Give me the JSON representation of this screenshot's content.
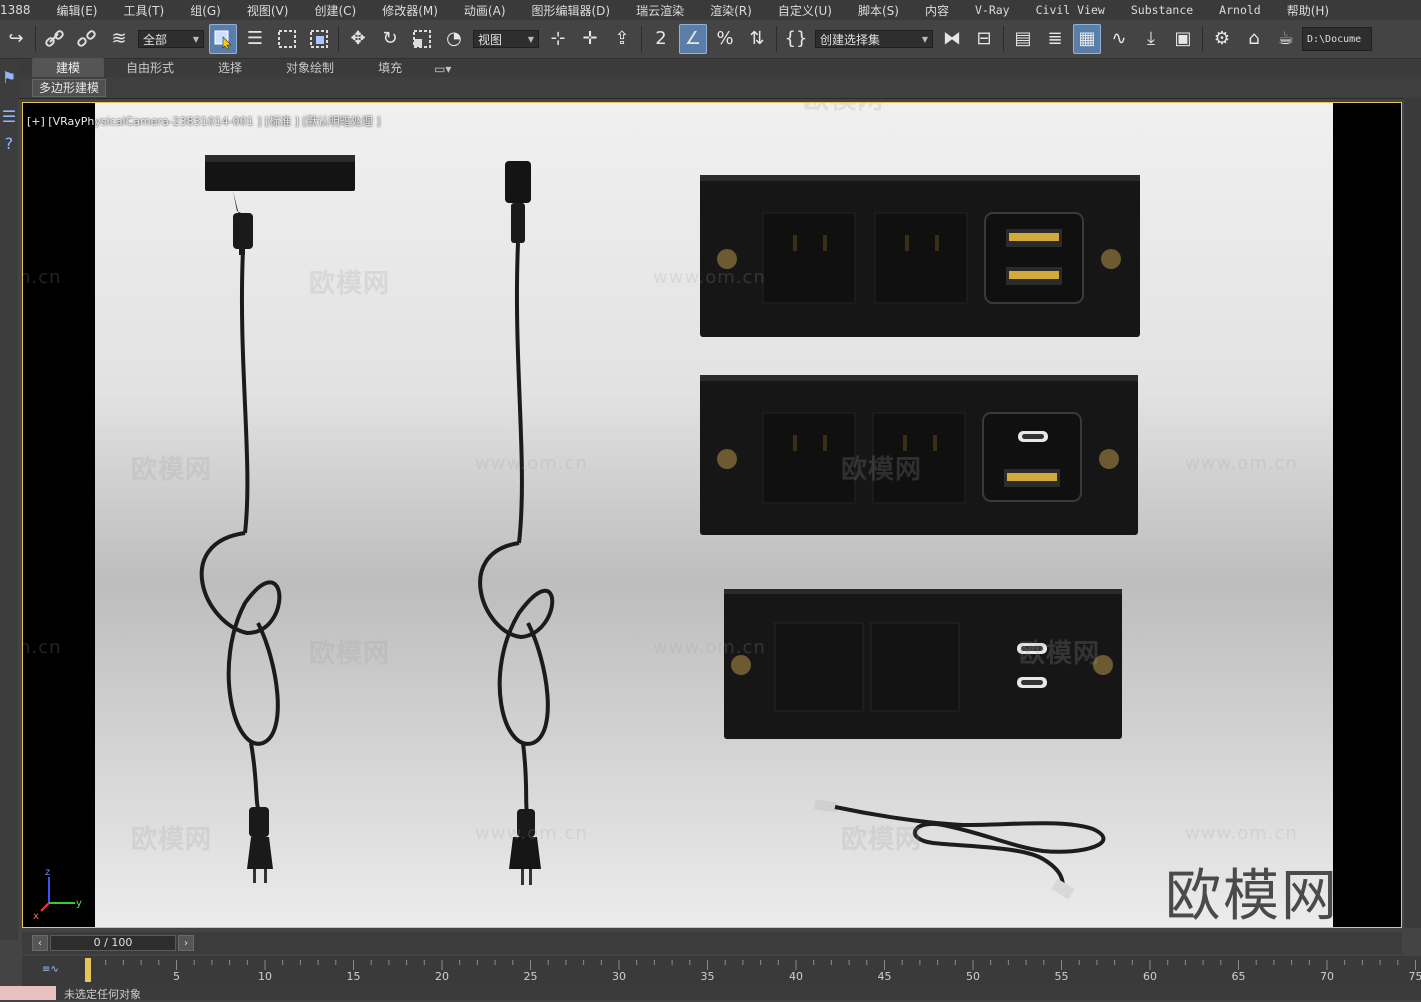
{
  "menu": {
    "app_fragment": "1388",
    "items": [
      "编辑(E)",
      "工具(T)",
      "组(G)",
      "视图(V)",
      "创建(C)",
      "修改器(M)",
      "动画(A)",
      "图形编辑器(D)",
      "瑞云渲染",
      "渲染(R)",
      "自定义(U)",
      "脚本(S)",
      "内容",
      "V-Ray",
      "Civil View",
      "Substance",
      "Arnold",
      "帮助(H)"
    ]
  },
  "toolbar": {
    "selection_filter": "全部",
    "reference_coord": "视图",
    "named_selection": "创建选择集",
    "project_path": "D:\\Docume"
  },
  "ribbon": {
    "tabs": [
      "建模",
      "自由形式",
      "选择",
      "对象绘制",
      "填充"
    ],
    "active_tab": "建模",
    "sub_tab": "多边形建模"
  },
  "viewport": {
    "label": "[+] [VRayPhysicalCamera-23831014-001 ] [标准 ] [默认明暗处理 ]",
    "watermark_cn": "欧模网",
    "watermark_url": "www.om.cn",
    "watermark_url_cut": "om.cn",
    "brand_mark": "欧模网",
    "axis_x": "x",
    "axis_y": "y",
    "axis_z": "z"
  },
  "timeline": {
    "frame_display": "0 / 100",
    "current_frame": 0,
    "total_frames": 100,
    "ticks": [
      0,
      5,
      10,
      15,
      20,
      25,
      30,
      35,
      40,
      45,
      50,
      55,
      60,
      65,
      70,
      75
    ]
  },
  "status": {
    "message": "未选定任何对象"
  },
  "colors": {
    "viewport_border": "#e3c55a",
    "active_tool": "#5b7ea8",
    "usb_gold": "#d4a93c"
  }
}
